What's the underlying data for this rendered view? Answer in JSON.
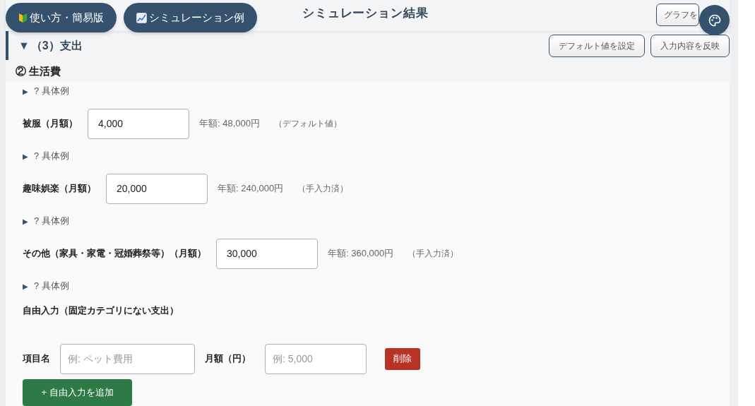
{
  "header": {
    "buttons": [
      {
        "label": "使い方・簡易版",
        "kind": "beginner"
      },
      {
        "label": "シミュレーション例",
        "kind": "chart"
      }
    ],
    "title": "シミュレーション結果",
    "graph_button": "グラフを"
  },
  "section": {
    "toggle": "▼",
    "title": "（3）支出",
    "buttons": [
      "デフォルト値を設定",
      "入力内容を反映"
    ]
  },
  "subsection": "② 生活費",
  "items": [
    {
      "example_toggle": "▶",
      "example_label": "? 具体例",
      "label": "被服（月額）",
      "value": "4,000",
      "annual": "年額: 48,000円",
      "note": "（デフォルト値）"
    },
    {
      "example_toggle": "▶",
      "example_label": "? 具体例",
      "label": "趣味娯楽（月額）",
      "value": "20,000",
      "annual": "年額: 240,000円",
      "note": "（手入力済）"
    },
    {
      "example_toggle": "▶",
      "example_label": "? 具体例",
      "label": "その他（家具・家電・冠婚葬祭等）（月額）",
      "value": "30,000",
      "annual": "年額: 360,000円",
      "note": "（手入力済）"
    }
  ],
  "trailing_example": {
    "example_toggle": "▶",
    "example_label": "? 具体例"
  },
  "free_input": {
    "heading": "自由入力（固定カテゴリにない支出）",
    "rows": [
      {
        "name_label": "項目名",
        "name_placeholder": "例: ペット費用",
        "amount_label": "月額（円）",
        "amount_placeholder": "例: 5,000",
        "delete": "削除"
      }
    ],
    "add_button": "+ 自由入力を追加"
  }
}
